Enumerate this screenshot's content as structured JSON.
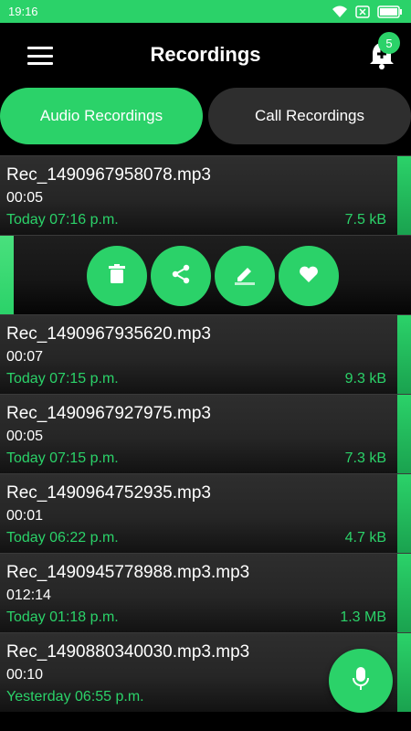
{
  "status_bar": {
    "time": "19:16",
    "icons": [
      "wifi-icon",
      "sim-off-icon",
      "battery-icon"
    ]
  },
  "app_bar": {
    "title": "Recordings",
    "menu_icon": "hamburger-menu-icon",
    "notification_icon": "bell-add-icon",
    "notification_count": "5"
  },
  "tabs": [
    {
      "label": "Audio Recordings",
      "active": true
    },
    {
      "label": "Call Recordings",
      "active": false
    }
  ],
  "recordings": [
    {
      "name": "Rec_1490967958078.mp3",
      "duration": "00:05",
      "date": "Today 07:16 p.m.",
      "size": "7.5 kB"
    },
    {
      "name": "Rec_1490967935620.mp3",
      "duration": "00:07",
      "date": "Today 07:15 p.m.",
      "size": "9.3 kB"
    },
    {
      "name": "Rec_1490967927975.mp3",
      "duration": "00:05",
      "date": "Today 07:15 p.m.",
      "size": "7.3 kB"
    },
    {
      "name": "Rec_1490964752935.mp3",
      "duration": "00:01",
      "date": "Today 06:22 p.m.",
      "size": "4.7 kB"
    },
    {
      "name": "Rec_1490945778988.mp3.mp3",
      "duration": "012:14",
      "date": "Today 01:18 p.m.",
      "size": "1.3 MB"
    },
    {
      "name": "Rec_1490880340030.mp3.mp3",
      "duration": "00:10",
      "date": "Yesterday 06:55 p.m.",
      "size": ""
    }
  ],
  "actions": [
    "delete-icon",
    "share-icon",
    "edit-icon",
    "favorite-icon"
  ],
  "fab_icon": "microphone-icon",
  "colors": {
    "accent": "#2bd269",
    "background": "#000000",
    "item_background": "#2e2e2e",
    "text": "#ffffff"
  }
}
